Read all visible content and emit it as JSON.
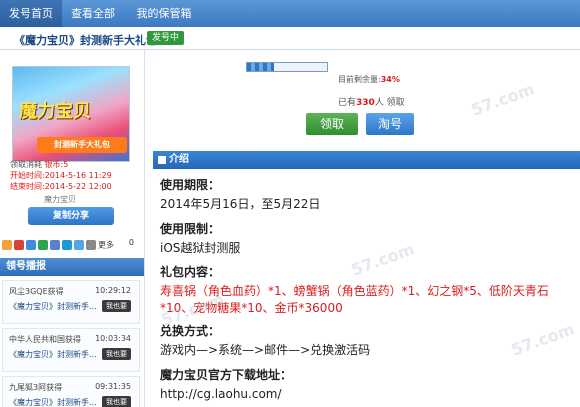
{
  "nav": {
    "tabs": [
      "发号首页",
      "查看全部",
      "我的保管箱"
    ]
  },
  "title": {
    "breadcrumb": "《魔力宝贝》封测新手大礼包",
    "status_badge": "发号中"
  },
  "gift": {
    "cover_logo": "魔力宝贝",
    "cover_ribbon": "封测新手大礼包",
    "consume_label": "领取消耗",
    "consume_value": "银币:5",
    "start_label": "开始时间:",
    "start_value": "2014-5-16 11:29",
    "end_label": "结束时间:",
    "end_value": "2014-5-22 12:00",
    "category": "魔力宝贝",
    "share_button": "复制分享",
    "more": "更多",
    "share_count": "0"
  },
  "stock": {
    "remain_label": "目前剩余量:",
    "remain_pct": "34%",
    "progress_fraction": 0.34,
    "claimed_prefix": "已有",
    "claimed_count": "330",
    "claimed_suffix": "人 领取",
    "claim_button": "领取",
    "tao_button": "淘号"
  },
  "feed": {
    "title": "领号播报",
    "items": [
      {
        "who": "风尘3GQE获得",
        "time": "10:29:12",
        "what": "《魔力宝贝》封测新手...",
        "button": "我也要"
      },
      {
        "who": "中华人民共和国获得",
        "time": "10:03:34",
        "what": "《魔力宝贝》封测新手...",
        "button": "我也要"
      },
      {
        "who": "九尾狐3阿获得",
        "time": "09:31:35",
        "what": "《魔力宝贝》封测新手...",
        "button": "我也要"
      }
    ]
  },
  "intro": {
    "section_title": "介绍",
    "usage_period_label": "使用期限：",
    "usage_period_value": "2014年5月16日，至5月22日",
    "usage_limit_label": "使用限制：",
    "usage_limit_value": "iOS越狱封测服",
    "contents_label": "礼包内容：",
    "contents_value": "寿喜锅（角色血药）*1、螃蟹锅（角色蓝药）*1、幻之钢*5、低阶天青石*10、宠物糖果*10、金币*36000",
    "redeem_label": "兑换方式：",
    "redeem_value": "游戏内—>系统—>邮件—>兑换激活码",
    "download_label": "魔力宝贝官方下载地址：",
    "download_value": "http://cg.laohu.com/"
  },
  "colors": {
    "nav_blue": "#3c79c2",
    "accent_red": "#d91c1c",
    "claim_green": "#2f8f2d"
  },
  "watermark": "57.com"
}
